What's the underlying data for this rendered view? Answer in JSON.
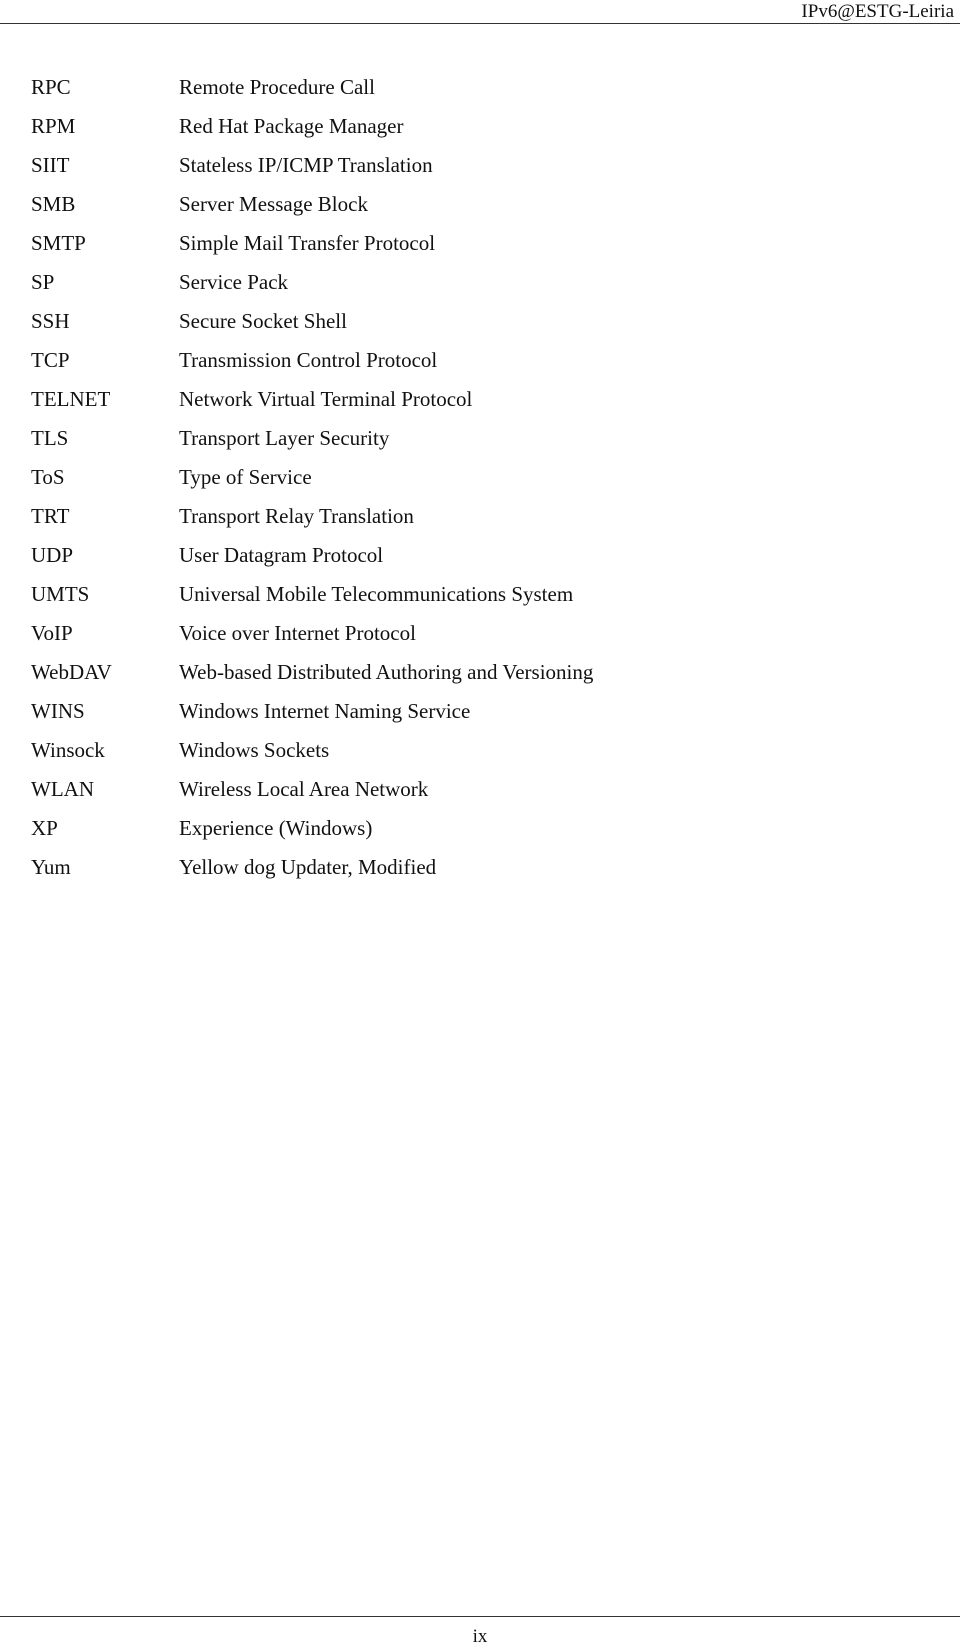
{
  "header": {
    "title": "IPv6@ESTG-Leiria"
  },
  "entries": [
    {
      "abbr": "RPC",
      "def": "Remote Procedure Call"
    },
    {
      "abbr": "RPM",
      "def": "Red Hat Package Manager"
    },
    {
      "abbr": "SIIT",
      "def": "Stateless IP/ICMP Translation"
    },
    {
      "abbr": "SMB",
      "def": "Server Message Block"
    },
    {
      "abbr": "SMTP",
      "def": "Simple Mail Transfer Protocol"
    },
    {
      "abbr": "SP",
      "def": "Service Pack"
    },
    {
      "abbr": "SSH",
      "def": "Secure Socket Shell"
    },
    {
      "abbr": "TCP",
      "def": "Transmission Control Protocol"
    },
    {
      "abbr": "TELNET",
      "def": "Network Virtual Terminal Protocol"
    },
    {
      "abbr": "TLS",
      "def": "Transport Layer Security"
    },
    {
      "abbr": "ToS",
      "def": "Type of Service"
    },
    {
      "abbr": "TRT",
      "def": "Transport Relay Translation"
    },
    {
      "abbr": "UDP",
      "def": "User Datagram Protocol"
    },
    {
      "abbr": "UMTS",
      "def": "Universal Mobile Telecommunications System"
    },
    {
      "abbr": "VoIP",
      "def": "Voice over Internet Protocol"
    },
    {
      "abbr": "WebDAV",
      "def": "Web-based Distributed Authoring and Versioning"
    },
    {
      "abbr": "WINS",
      "def": "Windows Internet Naming Service"
    },
    {
      "abbr": "Winsock",
      "def": "Windows Sockets"
    },
    {
      "abbr": "WLAN",
      "def": "Wireless Local Area Network"
    },
    {
      "abbr": "XP",
      "def": "Experience (Windows)"
    },
    {
      "abbr": "Yum",
      "def": "Yellow dog Updater, Modified"
    }
  ],
  "footer": {
    "page_number": "ix"
  }
}
